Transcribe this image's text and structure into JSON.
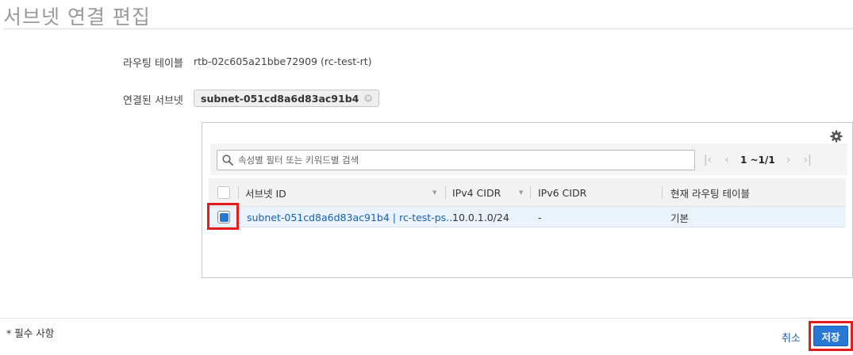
{
  "header": {
    "title": "서브넷 연결 편집"
  },
  "form": {
    "route_table_label": "라우팅 테이블",
    "route_table_value": "rtb-02c605a21bbe72909 (rc-test-rt)",
    "associated_subnets_label": "연결된 서브넷",
    "selected_chip": "subnet-051cd8a6d83ac91b4"
  },
  "panel": {
    "settings_icon": "gear-icon",
    "search": {
      "placeholder": "속성별 필터 또는 키워드별 검색",
      "icon": "search-icon"
    },
    "pager": {
      "text": "1 ~1/1"
    },
    "table": {
      "columns": [
        "서브넷 ID",
        "IPv4 CIDR",
        "IPv6 CIDR",
        "현재 라우팅 테이블"
      ],
      "rows": [
        {
          "selected": true,
          "subnet_id": "subnet-051cd8a6d83ac91b4 | rc-test-ps...",
          "ipv4": "10.0.1.0/24",
          "ipv6": "-",
          "route_table": "기본"
        }
      ]
    }
  },
  "footer": {
    "required_note": "* 필수 사항",
    "cancel_label": "취소",
    "save_label": "저장"
  },
  "colors": {
    "accent": "#2777d5",
    "highlight": "#e31b1b",
    "link": "#1a5fb4"
  }
}
